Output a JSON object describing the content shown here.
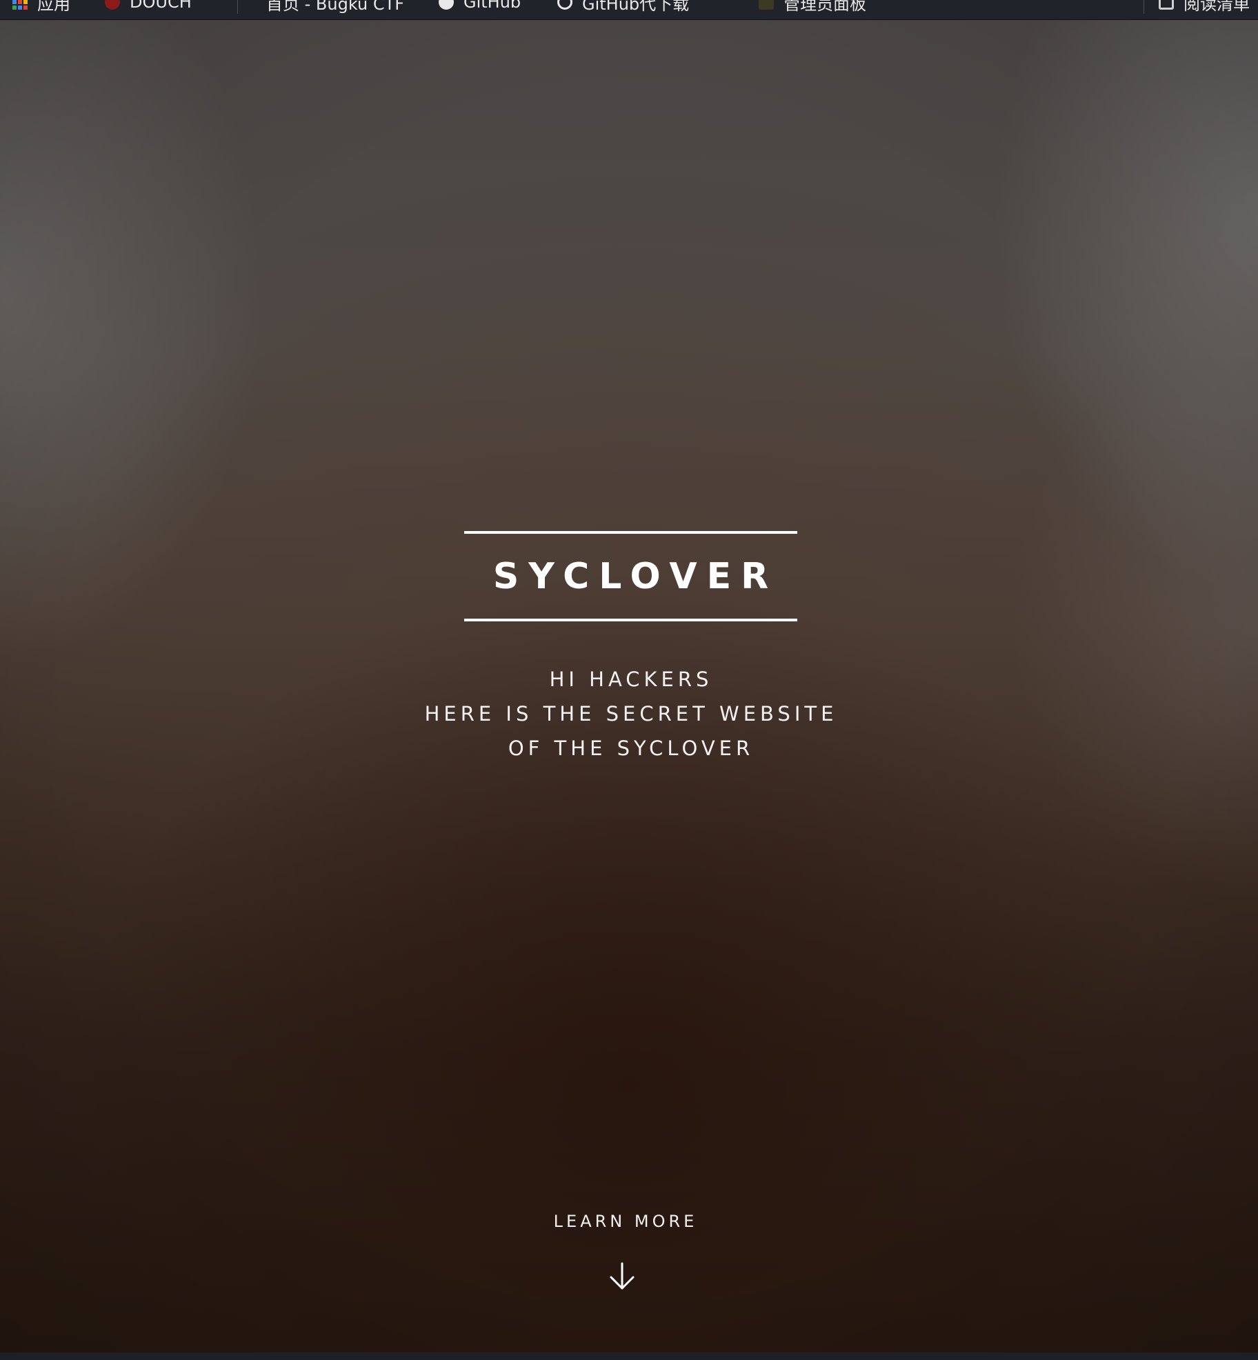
{
  "bookmarks": {
    "items": [
      {
        "label": "应用",
        "icon": "apps-icon"
      },
      {
        "label": "DOUCH",
        "icon": "red-dot-icon"
      },
      {
        "label": "首页 - Bugku CTF",
        "icon": "globe-icon"
      },
      {
        "label": "GitHub",
        "icon": "github-icon"
      },
      {
        "label": "GitHub代下载",
        "icon": "globe-icon"
      },
      {
        "label": "管理员面板",
        "icon": "folder-icon"
      }
    ],
    "reading_list": "阅读清单"
  },
  "hero": {
    "title": "SYCLOVER",
    "tagline": [
      "HI HACKERS",
      "HERE IS THE SECRET WEBSITE",
      "OF THE SYCLOVER"
    ],
    "learn_more": "LEARN MORE"
  }
}
